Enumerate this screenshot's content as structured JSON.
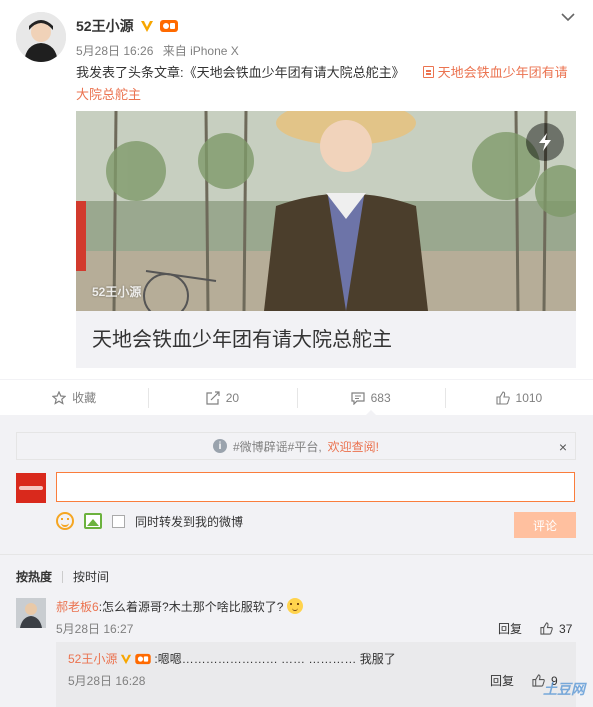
{
  "post": {
    "author": "52王小源",
    "date": "5月28日 16:26",
    "source": "来自 iPhone X",
    "text_prefix": "我发表了头条文章:《天地会铁血少年团有请大院总舵主》",
    "article_link": "天地会铁血少年团有请大院总舵主",
    "card": {
      "watermark": "52王小源",
      "title": "天地会铁血少年团有请大院总舵主"
    }
  },
  "actions": {
    "favorite_label": "收藏",
    "repost_count": "20",
    "comment_count": "683",
    "like_count": "1010"
  },
  "comment_box": {
    "notice_text": "#微博辟谣#平台,",
    "notice_link": "欢迎查阅!",
    "notice_close": "×",
    "input_value": "",
    "repost_checkbox_label": "同时转发到我的微博",
    "submit_label": "评论"
  },
  "sort": {
    "by_hot": "按热度",
    "by_time": "按时间"
  },
  "comments": [
    {
      "name": "郝老板6",
      "text": ":怎么着源哥?木土那个啥比服软了?",
      "time": "5月28日 16:27",
      "reply_label": "回复",
      "likes": "37",
      "replies": [
        {
          "name": "52王小源",
          "text": ":嗯嗯…………………… …… ………… 我服了",
          "time": "5月28日 16:28",
          "reply_label": "回复",
          "likes": "9"
        }
      ]
    }
  ],
  "watermark": "土豆网",
  "colors": {
    "accent": "#eb7350",
    "input_border": "#fa7d3c",
    "submit_disabled": "#ffc09f",
    "panel_bg": "#f2f2f5"
  }
}
